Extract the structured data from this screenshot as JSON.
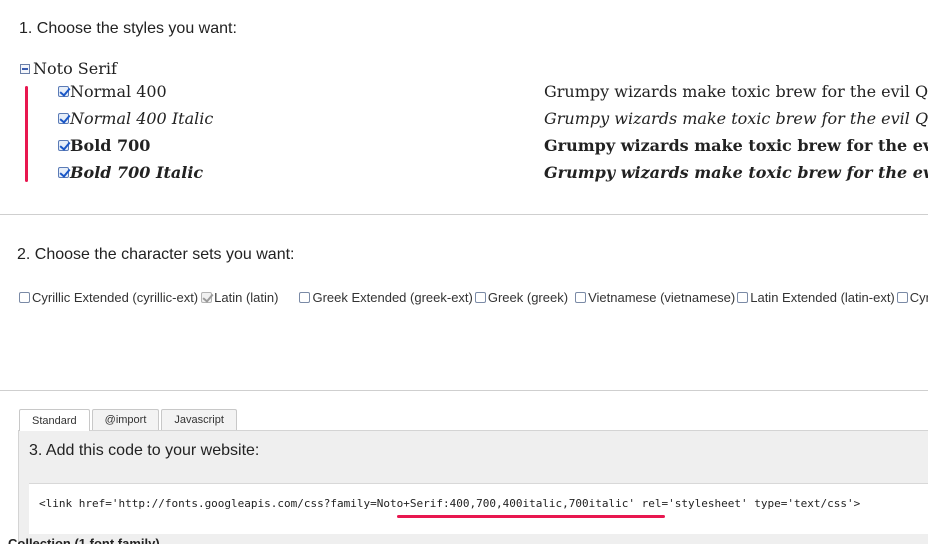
{
  "step1": {
    "title": "1. Choose the styles you want:",
    "family_name": "Noto Serif",
    "styles": [
      {
        "label": "Normal 400",
        "checked": true
      },
      {
        "label": "Normal 400 Italic",
        "checked": true
      },
      {
        "label": "Bold 700",
        "checked": true
      },
      {
        "label": "Bold 700 Italic",
        "checked": true
      }
    ],
    "previews": [
      "Grumpy wizards make toxic brew for the evil Queen",
      "Grumpy wizards make toxic brew for the evil Queen",
      "Grumpy wizards make toxic brew for the evil Queen",
      "Grumpy wizards make toxic brew for the evil Queen"
    ]
  },
  "step2": {
    "title": "2. Choose the character sets you want:",
    "charsets": [
      {
        "label": "Cyrillic Extended (cyrillic-ext)",
        "checked": false
      },
      {
        "label": "Latin (latin)",
        "checked": true,
        "disabled": true
      },
      {
        "label": "Greek Extended (greek-ext)",
        "checked": false
      },
      {
        "label": "Greek (greek)",
        "checked": false
      },
      {
        "label": "Vietnamese (vietnamese)",
        "checked": false
      },
      {
        "label": "Latin Extended (latin-ext)",
        "checked": false
      },
      {
        "label": "Cyrillic (cyrillic)",
        "checked": false
      }
    ]
  },
  "step3": {
    "tabs": [
      "Standard",
      "@import",
      "Javascript"
    ],
    "active_tab": "Standard",
    "title": "3. Add this code to your website:",
    "code": "<link href='http://fonts.googleapis.com/css?family=Noto+Serif:400,700,400italic,700italic' rel='stylesheet' type='text/css'>"
  },
  "footer_partial": "Collection (1 font family)",
  "colors": {
    "annotation": "#e8174f",
    "divider": "#cfcfcf",
    "code_panel": "#efefef"
  }
}
